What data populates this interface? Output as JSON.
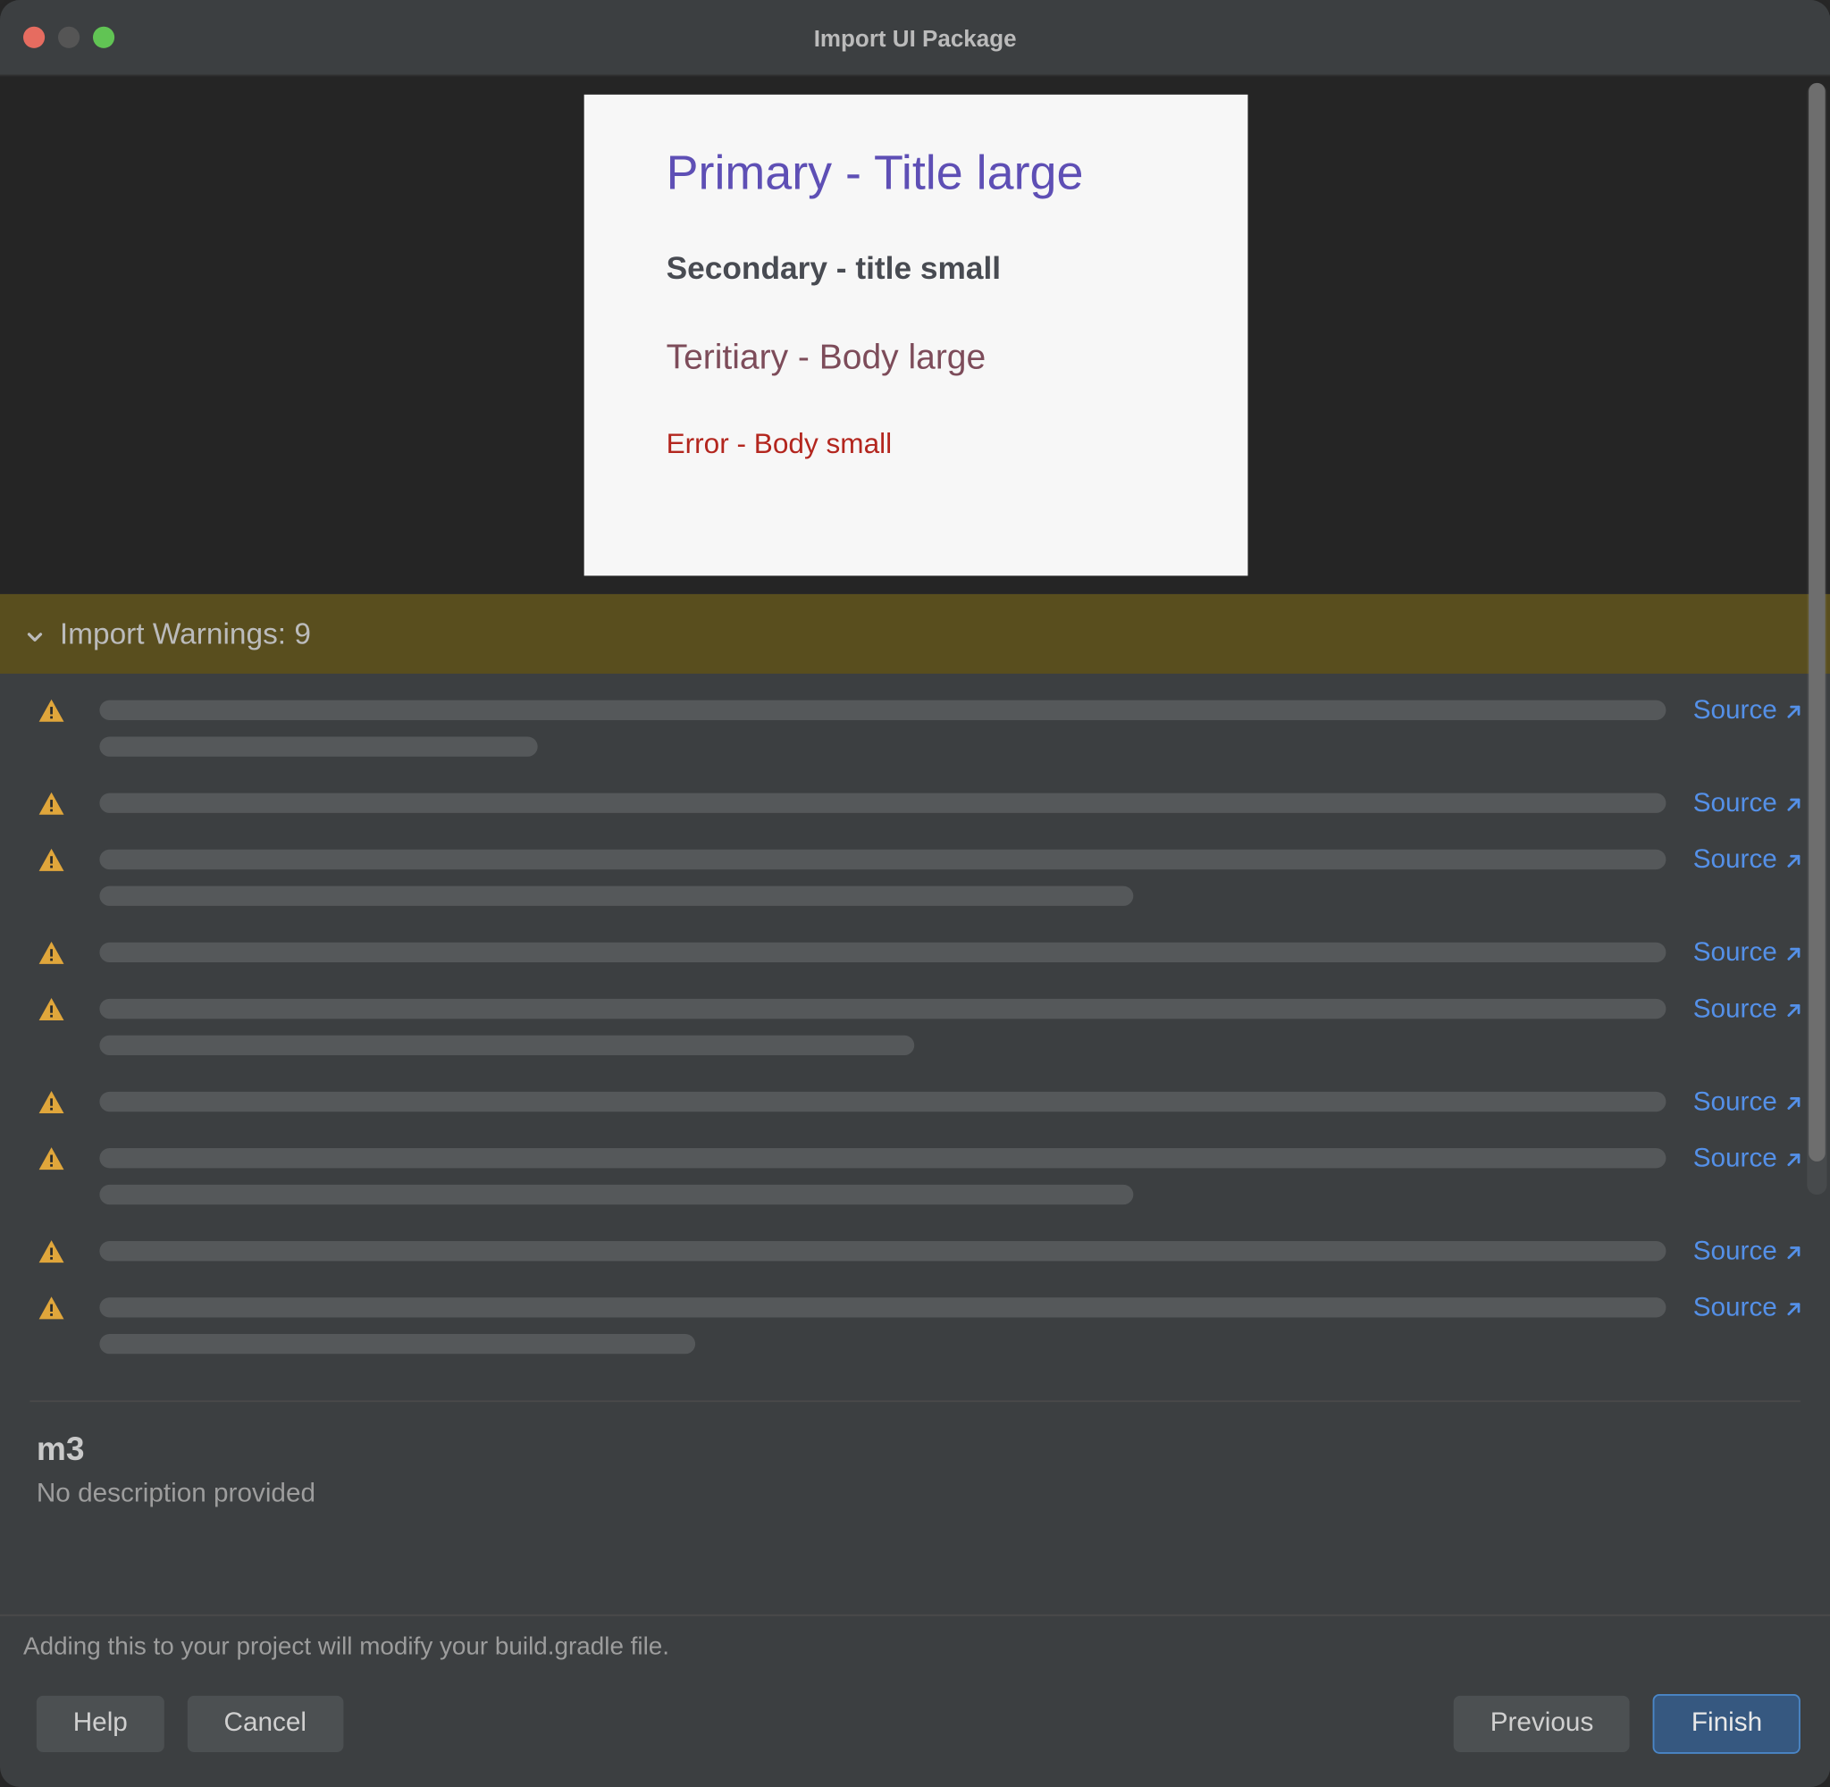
{
  "window": {
    "title": "Import UI Package"
  },
  "preview": {
    "primary": "Primary - Title large",
    "secondary": "Secondary - title small",
    "tertiary": "Teritiary - Body large",
    "error": "Error - Body small"
  },
  "warnings": {
    "header_label": "Import Warnings: 9",
    "source_label": "Source",
    "items": [
      {
        "line2_pct": 28
      },
      {},
      {
        "line2_pct": 66
      },
      {},
      {
        "line2_pct": 52
      },
      {},
      {
        "line2_pct": 66
      },
      {},
      {
        "line2_pct": 38
      }
    ]
  },
  "summary": {
    "name": "m3",
    "description": "No description provided"
  },
  "footer": {
    "note": "Adding this to your project will modify your build.gradle file.",
    "help": "Help",
    "cancel": "Cancel",
    "previous": "Previous",
    "finish": "Finish"
  }
}
